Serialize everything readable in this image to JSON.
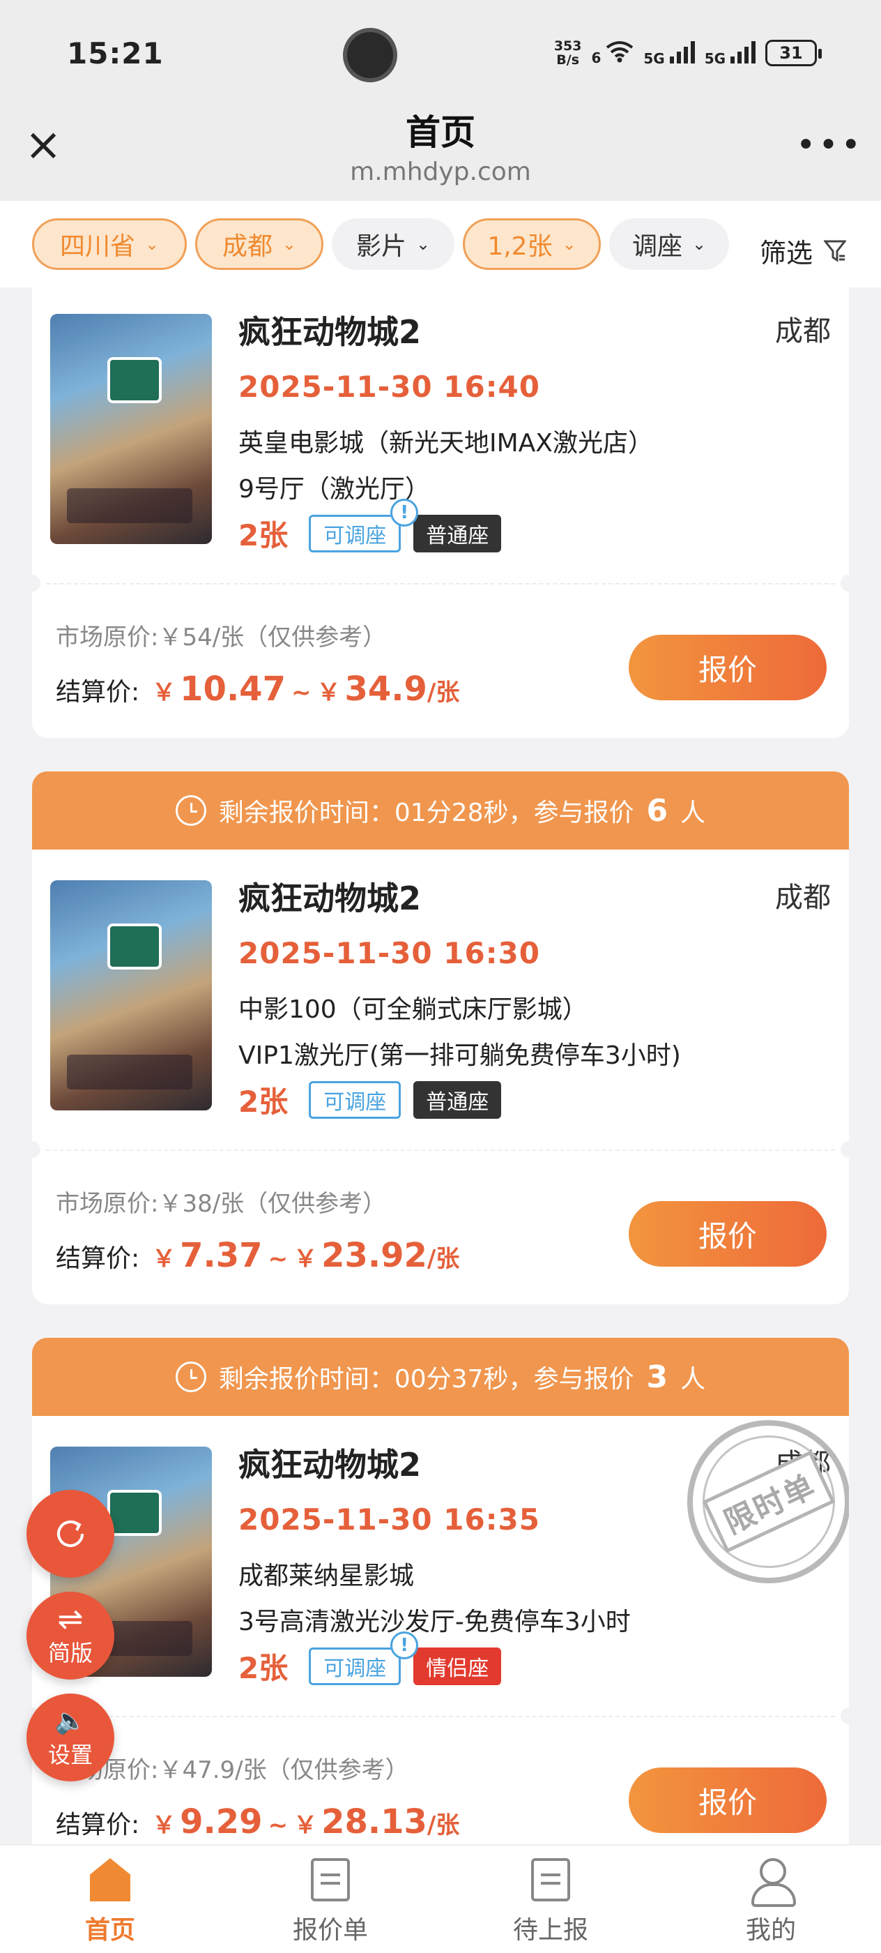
{
  "status_bar": {
    "time": "15:21",
    "net_speed_value": "353",
    "net_speed_unit": "B/s",
    "wifi_label": "6",
    "sim1_label": "5G",
    "sim2_label": "5G",
    "battery": "31"
  },
  "nav": {
    "title": "首页",
    "subtitle": "m.mhdyp.com"
  },
  "filters": {
    "province": "四川省",
    "city": "成都",
    "movie": "影片",
    "quantity": "1,2张",
    "seat_adjust": "调座",
    "filter_label": "筛选"
  },
  "cards": [
    {
      "movie": "疯狂动物城2",
      "city": "成都",
      "showtime": "2025-11-30 16:40",
      "cinema": "英皇电影城（新光天地IMAX激光店）",
      "hall": "9号厅（激光厅）",
      "qty": "2张",
      "adjust_tag": "可调座",
      "seat_tag": "普通座",
      "market_price": "市场原价:￥54/张（仅供参考）",
      "settle_label": "结算价:",
      "price_low": "10.47",
      "price_high": "34.9",
      "quote_btn": "报价"
    },
    {
      "timer_text": "剩余报价时间：01分28秒，参与报价",
      "participants": "6",
      "participants_unit": "人",
      "movie": "疯狂动物城2",
      "city": "成都",
      "showtime": "2025-11-30 16:30",
      "cinema": "中影100（可全躺式床厅影城）",
      "hall": "VIP1激光厅(第一排可躺免费停车3小时)",
      "qty": "2张",
      "adjust_tag": "可调座",
      "seat_tag": "普通座",
      "market_price": "市场原价:￥38/张（仅供参考）",
      "settle_label": "结算价:",
      "price_low": "7.37",
      "price_high": "23.92",
      "quote_btn": "报价"
    },
    {
      "timer_text": "剩余报价时间：00分37秒，参与报价",
      "participants": "3",
      "participants_unit": "人",
      "movie": "疯狂动物城2",
      "city": "成都",
      "showtime": "2025-11-30 16:35",
      "cinema": "成都莱纳星影城",
      "hall": "3号高清激光沙发厅-免费停车3小时",
      "qty": "2张",
      "adjust_tag": "可调座",
      "seat_tag": "情侣座",
      "stamp": "限时单",
      "market_price": "市场原价:￥47.9/张（仅供参考）",
      "settle_label": "结算价:",
      "price_low": "9.29",
      "price_high": "28.13",
      "quote_btn": "报价"
    }
  ],
  "price_symbols": {
    "currency": "￥",
    "range": "~",
    "per": "/张"
  },
  "fabs": {
    "refresh_icon": "refresh-icon",
    "simple_label": "简版",
    "settings_label": "设置"
  },
  "tabs": [
    {
      "label": "首页",
      "active": true
    },
    {
      "label": "报价单",
      "active": false
    },
    {
      "label": "待上报",
      "active": false
    },
    {
      "label": "我的",
      "active": false
    }
  ],
  "colors": {
    "accent": "#ee7a2e",
    "price": "#e5603a",
    "timer_bg": "#f0964e",
    "tag_blue": "#4aa3e0",
    "seat_normal": "#333333",
    "seat_couple": "#e23a2e"
  }
}
